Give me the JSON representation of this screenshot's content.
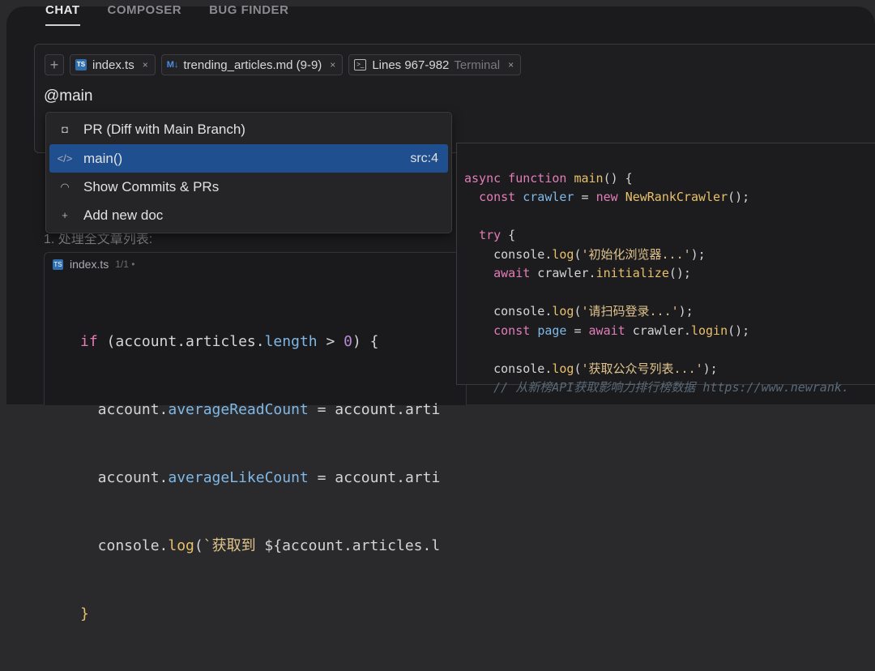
{
  "tabs": [
    {
      "label": "CHAT",
      "active": true
    },
    {
      "label": "COMPOSER",
      "active": false
    },
    {
      "label": "BUG FINDER",
      "active": false
    }
  ],
  "context_chips": {
    "add_symbol": "+",
    "items": [
      {
        "icon": "ts-file-icon",
        "icon_text": "TS",
        "label": "index.ts",
        "suffix": ""
      },
      {
        "icon": "markdown-icon",
        "icon_text": "M↓",
        "label": "trending_articles.md (9-9)",
        "suffix": ""
      },
      {
        "icon": "terminal-icon",
        "icon_text": ">_",
        "label": "Lines 967-982",
        "suffix": "Terminal"
      }
    ],
    "close_symbol": "×"
  },
  "mention_text": "@main",
  "menu": {
    "items": [
      {
        "icon": "diff-icon",
        "glyph": "◘",
        "label": "PR (Diff with Main Branch)",
        "hint": ""
      },
      {
        "icon": "code-icon",
        "glyph": "</>",
        "label": "main()",
        "hint": "src:4",
        "selected": true
      },
      {
        "icon": "commits-icon",
        "glyph": "◠",
        "label": "Show Commits & PRs",
        "hint": ""
      },
      {
        "icon": "plus-icon",
        "glyph": "+",
        "label": "Add new doc",
        "hint": ""
      }
    ]
  },
  "background": {
    "line_text": "1. 处理全文章列表:",
    "code_file": "index.ts",
    "code_file_count": "1/1 •",
    "code_lines": [
      "if (account.articles.length > 0) {",
      "  account.averageReadCount = account.arti",
      "  account.averageLikeCount = account.arti",
      "  console.log(`获取到 ${account.articles.l",
      "}"
    ]
  },
  "preview_code": [
    "async function main() {",
    "  const crawler = new NewRankCrawler();",
    "",
    "  try {",
    "    console.log('初始化浏览器...');",
    "    await crawler.initialize();",
    "",
    "    console.log('请扫码登录...');",
    "    const page = await crawler.login();",
    "",
    "    console.log('获取公众号列表...');",
    "    // 从新榜API获取影响力排行榜数据 https://www.newrank."
  ],
  "colors": {
    "selected_row": "#1f4f8f",
    "keyword": "#e37db8",
    "function": "#e8c06a",
    "property": "#7fb8e6"
  }
}
